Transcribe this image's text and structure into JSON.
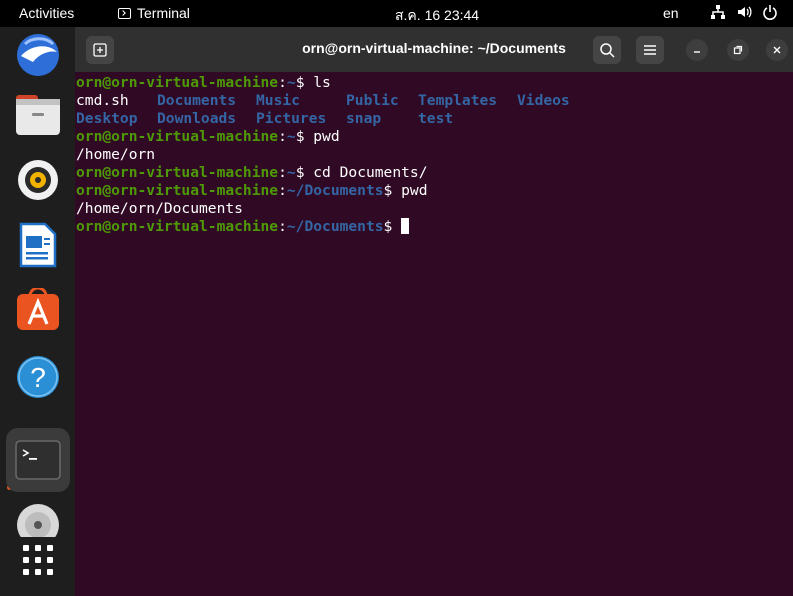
{
  "topbar": {
    "activities": "Activities",
    "app_name": "Terminal",
    "clock": "ส.ค. 16  23:44",
    "language": "en"
  },
  "dock": {
    "items": [
      "thunderbird",
      "files",
      "rhythmbox",
      "libreoffice-writer",
      "app-center",
      "help",
      "terminal",
      "dvd",
      "show-apps"
    ]
  },
  "window": {
    "title": "orn@orn-virtual-machine: ~/Documents"
  },
  "terminal": {
    "user": "orn@orn-virtual-machine",
    "lines": [
      {
        "path": "~",
        "cmd": " ls"
      },
      {
        "path": "~",
        "cmd": " pwd"
      },
      {
        "path": "~",
        "cmd": " cd Documents/"
      },
      {
        "path": "~/Documents",
        "cmd": " pwd"
      },
      {
        "path": "~/Documents",
        "cmd": " "
      }
    ],
    "ls_row1": [
      "cmd.sh",
      "Documents",
      "Music",
      "Public",
      "Templates",
      "Videos"
    ],
    "ls_row2": [
      "Desktop",
      "Downloads",
      "Pictures",
      "snap",
      "test"
    ],
    "out_home": "/home/orn",
    "out_docs": "/home/orn/Documents"
  },
  "colors": {
    "terminal_bg": "#300a24",
    "prompt_user": "#4e9a06",
    "prompt_path": "#3465a4",
    "accent": "#e95420"
  }
}
